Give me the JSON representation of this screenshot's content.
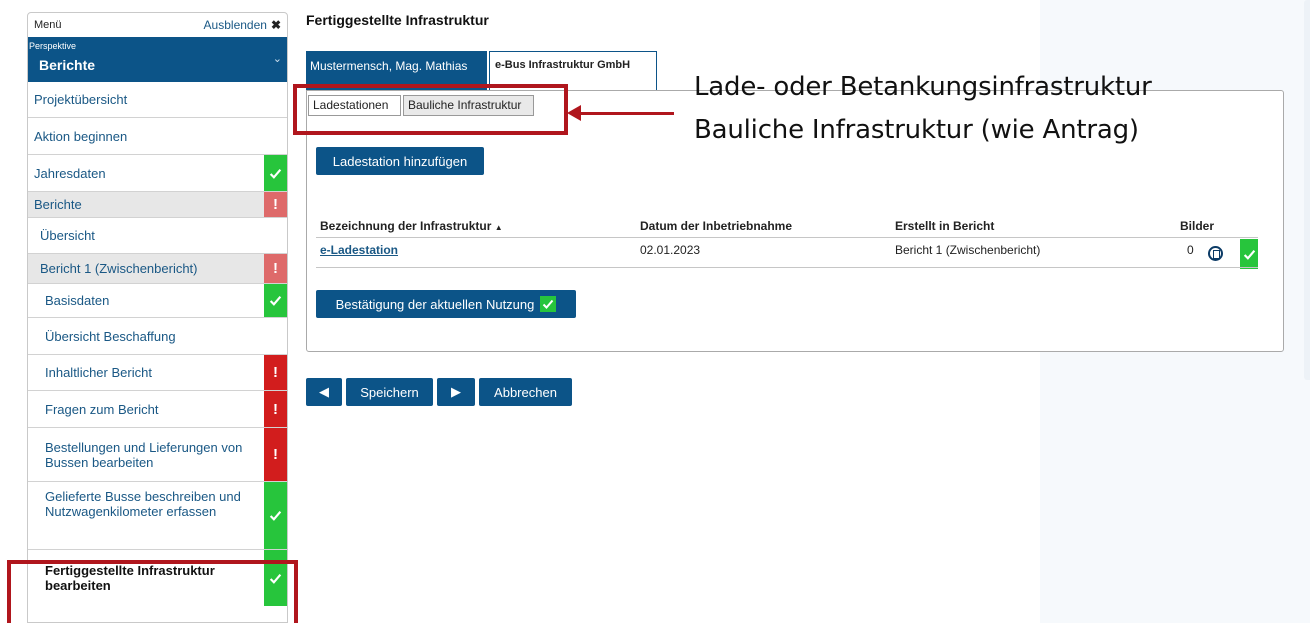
{
  "sidebar": {
    "menu_label": "Menü",
    "hide_label": "Ausblenden",
    "perspective_label": "Perspektive",
    "perspective_value": "Berichte",
    "items": [
      {
        "label": "Projektübersicht"
      },
      {
        "label": "Aktion beginnen"
      },
      {
        "label": "Jahresdaten",
        "status": "ok"
      },
      {
        "label": "Berichte",
        "status": "warning"
      },
      {
        "label": "Übersicht"
      },
      {
        "label": "Bericht 1 (Zwischenbericht)",
        "status": "warning"
      },
      {
        "label": "Basisdaten",
        "status": "ok"
      },
      {
        "label": "Übersicht Beschaffung"
      },
      {
        "label": "Inhaltlicher Bericht",
        "status": "warning"
      },
      {
        "label": "Fragen zum Bericht",
        "status": "warning"
      },
      {
        "label": "Bestellungen und Lieferungen von Bussen bearbeiten",
        "status": "warning"
      },
      {
        "label": "Gelieferte Busse beschreiben und Nutzwagenkilometer erfassen",
        "status": "ok"
      },
      {
        "label": "Fertiggestellte Infrastruktur bearbeiten",
        "status": "ok",
        "active": true
      }
    ]
  },
  "main": {
    "title": "Fertiggestellte Infrastruktur",
    "tabs": [
      "Mustermensch, Mag. Mathias",
      "e-Bus Infrastruktur GmbH"
    ],
    "subtabs": [
      "Ladestationen",
      "Bauliche Infrastruktur"
    ],
    "add_button": "Ladestation hinzufügen",
    "table": {
      "columns": [
        "Bezeichnung der Infrastruktur",
        "Datum der Inbetriebnahme",
        "Erstellt in Bericht",
        "Bilder"
      ],
      "sort_indicator": "▲",
      "rows": [
        {
          "name": "e-Ladestation",
          "date": "02.01.2023",
          "report": "Bericht 1 (Zwischenbericht)",
          "images": "0"
        }
      ]
    },
    "confirm_button": "Bestätigung der aktuellen Nutzung",
    "footer": {
      "save": "Speichern",
      "cancel": "Abbrechen"
    }
  },
  "annotations": {
    "line1": "Lade- oder Betankungsinfrastruktur",
    "line2": "Bauliche Infrastruktur (wie Antrag)",
    "color": "#b0161d"
  },
  "colors": {
    "brand": "#0c5488",
    "ok": "#27c53c",
    "warning": "#d21d1d",
    "link": "#1a5885"
  }
}
